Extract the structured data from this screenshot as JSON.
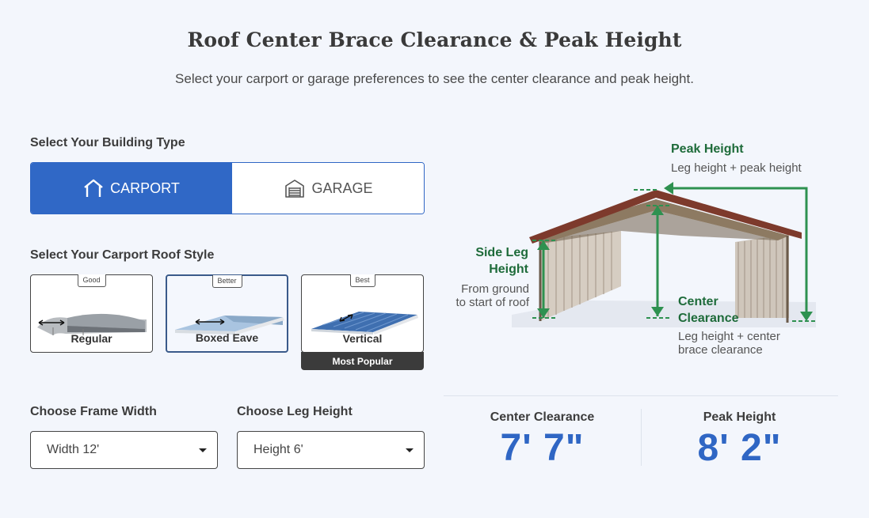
{
  "header": {
    "title": "Roof Center Brace Clearance & Peak Height",
    "subtitle": "Select your carport or garage preferences to see the center clearance and peak height."
  },
  "building_type": {
    "label": "Select Your Building Type",
    "options": [
      {
        "label": "CARPORT",
        "icon": "carport-icon",
        "selected": true
      },
      {
        "label": "GARAGE",
        "icon": "garage-icon",
        "selected": false
      }
    ]
  },
  "roof_style": {
    "label": "Select Your Carport Roof Style",
    "options": [
      {
        "tier": "Good",
        "name": "Regular",
        "selected": false
      },
      {
        "tier": "Better",
        "name": "Boxed Eave",
        "selected": true
      },
      {
        "tier": "Best",
        "name": "Vertical",
        "selected": false,
        "tag": "Most Popular"
      }
    ]
  },
  "frame_width": {
    "label": "Choose Frame Width",
    "value": "Width 12'"
  },
  "leg_height": {
    "label": "Choose Leg Height",
    "value": "Height 6'"
  },
  "diagram": {
    "peak": {
      "title": "Peak Height",
      "desc": "Leg height + peak height"
    },
    "side_leg": {
      "title_line1": "Side Leg",
      "title_line2": "Height",
      "desc_line1": "From ground",
      "desc_line2": "to start of roof"
    },
    "center": {
      "title_line1": "Center",
      "title_line2": "Clearance",
      "desc_line1": "Leg height + center",
      "desc_line2": "brace clearance"
    }
  },
  "results": {
    "center_clearance": {
      "label": "Center Clearance",
      "value": "7' 7\""
    },
    "peak_height": {
      "label": "Peak Height",
      "value": "8' 2\""
    }
  },
  "colors": {
    "accent": "#2f66c4",
    "green": "#2e9150",
    "roof_red": "#7a3b2b"
  }
}
